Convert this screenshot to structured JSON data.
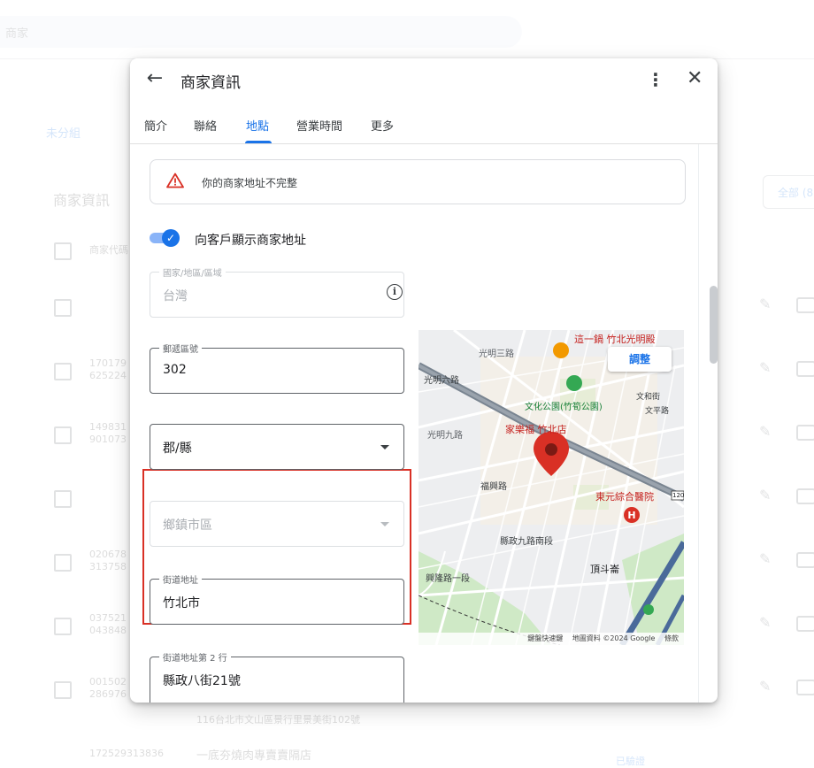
{
  "background": {
    "search_text": "商家",
    "group_label": "未分組",
    "section_title": "商家資訊",
    "all_button": "全部 (8",
    "header_col": "商家代碼",
    "rows": [
      {
        "line1": "",
        "line2": ""
      },
      {
        "line1": "170179",
        "line2": "625224"
      },
      {
        "line1": "149831",
        "line2": "901073"
      },
      {
        "line1": "",
        "line2": ""
      },
      {
        "line1": "020678",
        "line2": "313758"
      },
      {
        "line1": "037521",
        "line2": "043848"
      },
      {
        "line1": "001502",
        "line2": "286976"
      }
    ],
    "footer_address": "116台北市文山區景行里景美街102號",
    "footer_code": "1725293138​36",
    "footer_name": "一底夯燒肉專賣賣隔店",
    "footer_tag": "已驗證"
  },
  "dialog": {
    "title": "商家資訊",
    "tabs": [
      "簡介",
      "聯絡",
      "地點",
      "營業時間",
      "更多"
    ],
    "active_tab": 2,
    "warning": "你的商家地址不完整",
    "toggle_label": "向客戶顯示商家地址",
    "toggle_on": true,
    "fields": {
      "country": {
        "label": "國家/地區/區域",
        "value": "台灣"
      },
      "postal": {
        "label": "郵遞區號",
        "value": "302"
      },
      "county": {
        "label": "",
        "value": "郡/縣"
      },
      "township": {
        "label": "",
        "value": "鄉鎮市區"
      },
      "street": {
        "label": "街道地址",
        "value": "竹北市"
      },
      "street2": {
        "label": "街道地址第 2 行",
        "value": "縣政八街21號"
      }
    },
    "map": {
      "adjust_button": "調整",
      "labels": {
        "road_guangming3": "光明三路",
        "road_guangming6": "光明六路",
        "road_guangming9": "光明九路",
        "road_shinxing": "福興路",
        "road_xingzheng9": "縣政九路南段",
        "road_xinglong1": "興隆路一段",
        "park": "文化公園(竹筍公園)",
        "wenhe": "文和街",
        "wenping": "文平路",
        "carrefour": "家樂福 竹北店",
        "hospital": "東元綜合醫院",
        "dingdou": "頂斗崙",
        "restaurant": "這一鍋 竹北光明殿",
        "route": "120"
      },
      "footer": [
        "鍵盤快速鍵",
        "地圖資料 ©2024 Google",
        "條款"
      ]
    },
    "colors": {
      "accent": "#1a73e8",
      "warning": "#d93025",
      "pin": "#d93025"
    }
  }
}
